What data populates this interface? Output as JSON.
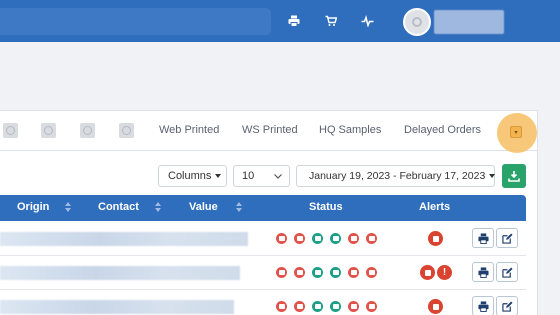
{
  "topbar": {
    "icons": [
      "print-icon",
      "cart-icon",
      "pulse-icon"
    ]
  },
  "tabs": {
    "items": [
      "Web Printed",
      "WS Printed",
      "HQ Samples",
      "Delayed Orders"
    ],
    "dropdown_icon": "chevron-down-icon"
  },
  "controls": {
    "columns_label": "Columns",
    "page_size": "10",
    "date_range": "January 19, 2023 - February 17, 2023",
    "download_icon": "download-icon"
  },
  "table": {
    "headers": {
      "origin": "Origin",
      "contact": "Contact",
      "value": "Value",
      "status": "Status",
      "alerts": "Alerts"
    },
    "status_icon_colors": [
      "#e0524a",
      "#e0524a",
      "#1d9e87",
      "#1d9e87",
      "#e0524a",
      "#e0524a"
    ],
    "rows": [
      {
        "alerts": [
          "stop"
        ]
      },
      {
        "alerts": [
          "stop",
          "exclamation"
        ]
      },
      {
        "alerts": [
          "stop"
        ]
      }
    ],
    "alert_text": {
      "exclamation": "!"
    }
  },
  "colors": {
    "primary": "#2f6dbd",
    "success": "#2aa36b",
    "danger": "#d9432f",
    "highlight": "#f6c26c"
  }
}
